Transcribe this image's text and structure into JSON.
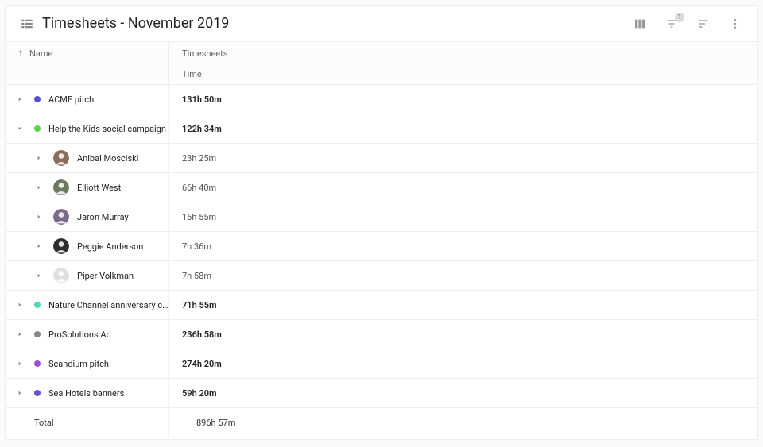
{
  "header": {
    "title": "Timesheets - November 2019"
  },
  "toolbar": {
    "filter_badge": "1"
  },
  "columns": {
    "name_label": "Name",
    "timesheets_label": "Timesheets",
    "time_label": "Time"
  },
  "projects": [
    {
      "name": "ACME pitch",
      "color": "#4f52d6",
      "time": "131h 50m",
      "expanded": false
    },
    {
      "name": "Help the Kids social campaign",
      "color": "#5ed24b",
      "time": "122h 34m",
      "expanded": true,
      "members": [
        {
          "name": "Anibal Mosciski",
          "time": "23h 25m",
          "avatar_bg": "#8a6d5a"
        },
        {
          "name": "Elliott West",
          "time": "66h 40m",
          "avatar_bg": "#6b7a5e"
        },
        {
          "name": "Jaron Murray",
          "time": "16h 55m",
          "avatar_bg": "#7a6b8a"
        },
        {
          "name": "Peggie Anderson",
          "time": "7h 36m",
          "avatar_bg": "#2d2d2d"
        },
        {
          "name": "Piper Volkman",
          "time": "7h 58m",
          "avatar_bg": "#e0e0e0"
        }
      ]
    },
    {
      "name": "Nature Channel anniversary cam...",
      "color": "#4fd6c0",
      "time": "71h 55m",
      "expanded": false
    },
    {
      "name": "ProSolutions Ad",
      "color": "#888888",
      "time": "236h 58m",
      "expanded": false
    },
    {
      "name": "Scandium pitch",
      "color": "#9b4fd6",
      "time": "274h 20m",
      "expanded": false
    },
    {
      "name": "Sea Hotels banners",
      "color": "#6b4fd6",
      "time": "59h 20m",
      "expanded": false
    }
  ],
  "total": {
    "label": "Total",
    "time": "896h 57m"
  }
}
